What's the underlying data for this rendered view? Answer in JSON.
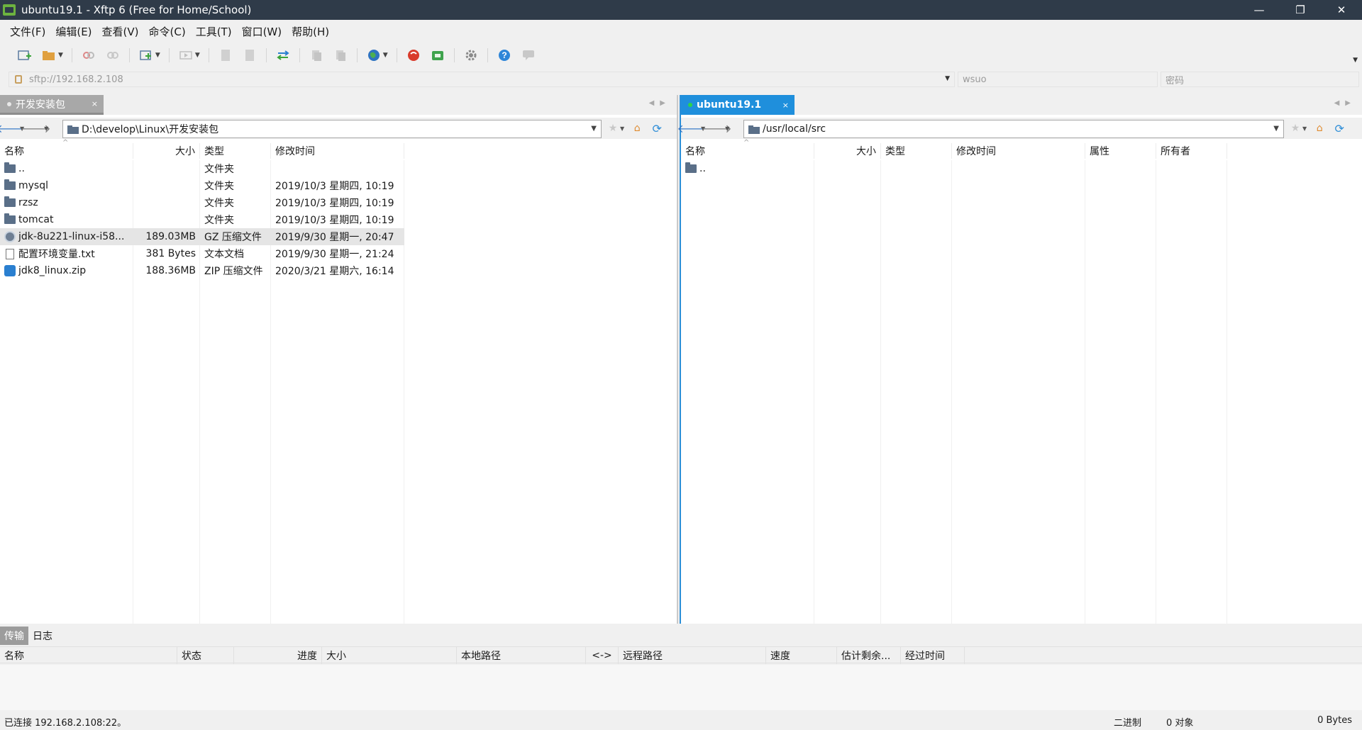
{
  "window": {
    "title": "ubuntu19.1 - Xftp 6 (Free for Home/School)",
    "controls": [
      "—",
      "❐",
      "✕"
    ]
  },
  "menu": [
    "文件(F)",
    "编辑(E)",
    "查看(V)",
    "命令(C)",
    "工具(T)",
    "窗口(W)",
    "帮助(H)"
  ],
  "toolbar": {
    "icons": [
      "new-session-icon",
      "open-folder-icon",
      "disconnect-icon",
      "reconnect-icon",
      "new-tab-icon",
      "sync-icon",
      "transfer-icon",
      "copy-icon",
      "paste-icon",
      "globe-icon",
      "xshell-icon",
      "xftp-icon",
      "settings-icon",
      "help-icon",
      "chat-icon"
    ]
  },
  "address": {
    "host": "sftp://192.168.2.108",
    "user_placeholder": "wsuo",
    "password_placeholder": "密码"
  },
  "local": {
    "tab_label": "开发安装包",
    "tab_close": "×",
    "path": "D:\\develop\\Linux\\开发安装包",
    "columns": {
      "name": "名称",
      "size": "大小",
      "type": "类型",
      "modified": "修改时间"
    },
    "files": [
      {
        "name": "..",
        "size": "",
        "type": "文件夹",
        "modified": "",
        "icon": "folder"
      },
      {
        "name": "mysql",
        "size": "",
        "type": "文件夹",
        "modified": "2019/10/3 星期四, 10:19",
        "icon": "folder"
      },
      {
        "name": "rzsz",
        "size": "",
        "type": "文件夹",
        "modified": "2019/10/3 星期四, 10:19",
        "icon": "folder"
      },
      {
        "name": "tomcat",
        "size": "",
        "type": "文件夹",
        "modified": "2019/10/3 星期四, 10:19",
        "icon": "folder"
      },
      {
        "name": "jdk-8u221-linux-i58...",
        "size": "189.03MB",
        "type": "GZ 压缩文件",
        "modified": "2019/9/30 星期一, 20:47",
        "icon": "gz"
      },
      {
        "name": "配置环境变量.txt",
        "size": "381 Bytes",
        "type": "文本文档",
        "modified": "2019/9/30 星期一, 21:24",
        "icon": "txt"
      },
      {
        "name": "jdk8_linux.zip",
        "size": "188.36MB",
        "type": "ZIP 压缩文件",
        "modified": "2020/3/21 星期六, 16:14",
        "icon": "zip"
      }
    ]
  },
  "remote": {
    "tab_label": "ubuntu19.1",
    "tab_close": "×",
    "path": "/usr/local/src",
    "columns": {
      "name": "名称",
      "size": "大小",
      "type": "类型",
      "modified": "修改时间",
      "attr": "属性",
      "owner": "所有者"
    },
    "files": [
      {
        "name": "..",
        "icon": "folder"
      }
    ]
  },
  "transfer": {
    "tabs": [
      "传输",
      "日志"
    ],
    "columns": [
      "名称",
      "状态",
      "进度",
      "大小",
      "本地路径",
      "<->",
      "远程路径",
      "速度",
      "估计剩余...",
      "经过时间"
    ]
  },
  "status": {
    "left": "已连接 192.168.2.108:22。",
    "mode": "二进制",
    "objects": "0 对象",
    "bytes": "0 Bytes"
  },
  "colors": {
    "titlebar": "#2f3b49",
    "active_tab": "#1f8fdc",
    "inactive_tab": "#a8a8a8",
    "selected_row": "#e5e5e5"
  }
}
